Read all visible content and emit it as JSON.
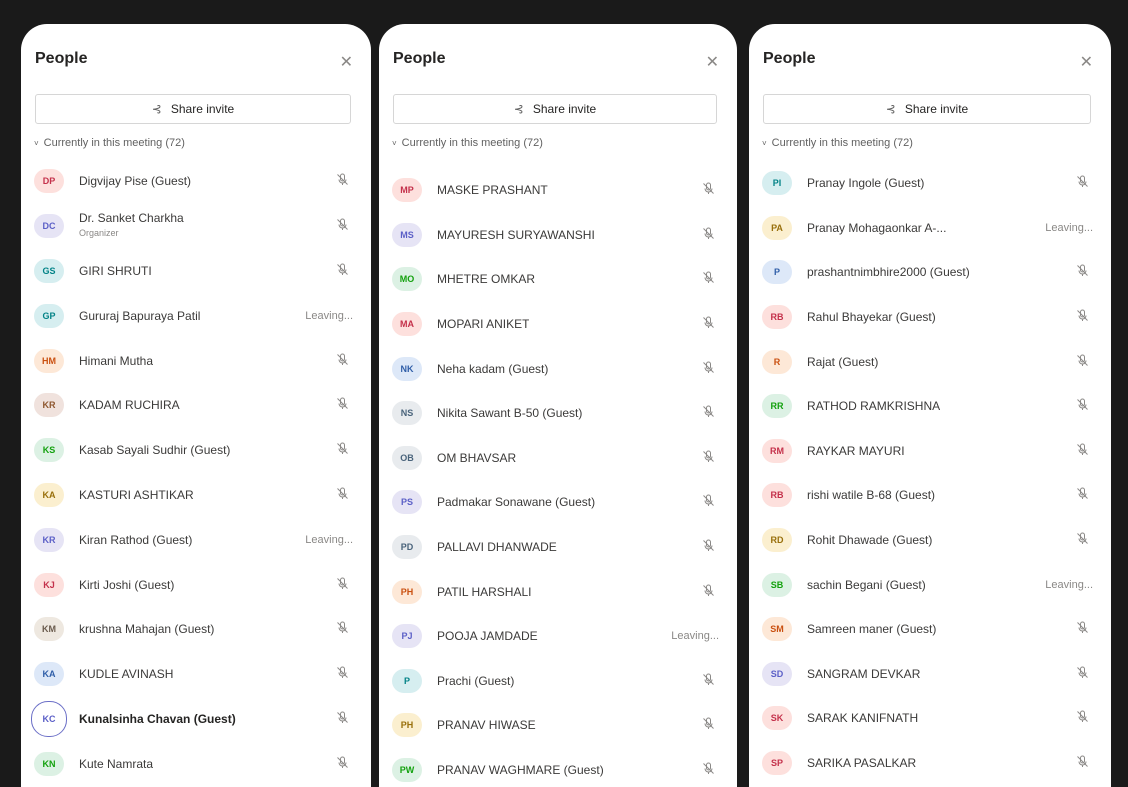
{
  "panel_title": "People",
  "share_label": "Share invite",
  "section_label": "Currently in this meeting (72)",
  "colors": {
    "red": "#c4314b",
    "lav": "#5b5fc7",
    "teal": "#038387",
    "green": "#13a10e",
    "orange": "#ca5010",
    "beige": "#8e562e",
    "yellow": "#986f0b",
    "blue": "#2f5ea8",
    "sand": "#6a5b4d",
    "gray": "#49637b"
  },
  "panels": [
    {
      "participants": [
        {
          "initials": "DP",
          "name": "Digvijay Pise (Guest)",
          "color": "red",
          "status": "muted"
        },
        {
          "initials": "DC",
          "name": "Dr. Sanket Charkha",
          "role": "Organizer",
          "color": "lav",
          "status": "muted"
        },
        {
          "initials": "GS",
          "name": "GIRI SHRUTI",
          "color": "teal",
          "status": "muted"
        },
        {
          "initials": "GP",
          "name": "Gururaj Bapuraya Patil",
          "color": "teal",
          "status": "Leaving..."
        },
        {
          "initials": "HM",
          "name": "Himani Mutha",
          "color": "orange",
          "status": "muted"
        },
        {
          "initials": "KR",
          "name": "KADAM RUCHIRA",
          "color": "beige",
          "status": "muted"
        },
        {
          "initials": "KS",
          "name": "Kasab Sayali Sudhir (Guest)",
          "color": "green",
          "status": "muted"
        },
        {
          "initials": "KA",
          "name": "KASTURI ASHTIKAR",
          "color": "yellow",
          "status": "muted"
        },
        {
          "initials": "KR",
          "name": "Kiran Rathod (Guest)",
          "color": "lav",
          "status": "Leaving..."
        },
        {
          "initials": "KJ",
          "name": "Kirti Joshi (Guest)",
          "color": "red",
          "status": "muted"
        },
        {
          "initials": "KM",
          "name": "krushna Mahajan (Guest)",
          "color": "sand",
          "status": "muted"
        },
        {
          "initials": "KA",
          "name": "KUDLE AVINASH",
          "color": "blue",
          "status": "muted"
        },
        {
          "initials": "KC",
          "name": "Kunalsinha Chavan (Guest)",
          "color": "white",
          "status": "muted",
          "bold": true
        },
        {
          "initials": "KN",
          "name": "Kute Namrata",
          "color": "green",
          "status": "muted"
        }
      ]
    },
    {
      "participants": [
        {
          "initials": "MP",
          "name": "MASKE PRASHANT",
          "color": "red",
          "status": "muted"
        },
        {
          "initials": "MS",
          "name": "MAYURESH SURYAWANSHI",
          "color": "lav",
          "status": "muted"
        },
        {
          "initials": "MO",
          "name": "MHETRE OMKAR",
          "color": "green",
          "status": "muted"
        },
        {
          "initials": "MA",
          "name": "MOPARI ANIKET",
          "color": "red",
          "status": "muted"
        },
        {
          "initials": "NK",
          "name": "Neha kadam (Guest)",
          "color": "blue",
          "status": "muted"
        },
        {
          "initials": "NS",
          "name": "Nikita Sawant B-50 (Guest)",
          "color": "gray",
          "status": "muted"
        },
        {
          "initials": "OB",
          "name": "OM BHAVSAR",
          "color": "gray",
          "status": "muted"
        },
        {
          "initials": "PS",
          "name": "Padmakar Sonawane (Guest)",
          "color": "lav",
          "status": "muted"
        },
        {
          "initials": "PD",
          "name": "PALLAVI DHANWADE",
          "color": "gray",
          "status": "muted"
        },
        {
          "initials": "PH",
          "name": "PATIL HARSHALI",
          "color": "orange",
          "status": "muted"
        },
        {
          "initials": "PJ",
          "name": "POOJA JAMDADE",
          "color": "lav",
          "status": "Leaving..."
        },
        {
          "initials": "P",
          "name": "Prachi (Guest)",
          "color": "teal",
          "status": "muted"
        },
        {
          "initials": "PH",
          "name": "PRANAV HIWASE",
          "color": "yellow",
          "status": "muted"
        },
        {
          "initials": "PW",
          "name": "PRANAV WAGHMARE (Guest)",
          "color": "green",
          "status": "muted"
        }
      ]
    },
    {
      "participants": [
        {
          "initials": "PI",
          "name": "Pranay Ingole (Guest)",
          "color": "teal",
          "status": "muted"
        },
        {
          "initials": "PA",
          "name": "Pranay Mohagaonkar A-...",
          "color": "yellow",
          "status": "Leaving..."
        },
        {
          "initials": "P",
          "name": "prashantnimbhire2000 (Guest)",
          "color": "blue",
          "status": "muted"
        },
        {
          "initials": "RB",
          "name": "Rahul Bhayekar (Guest)",
          "color": "red",
          "status": "muted"
        },
        {
          "initials": "R",
          "name": "Rajat (Guest)",
          "color": "orange",
          "status": "muted"
        },
        {
          "initials": "RR",
          "name": "RATHOD RAMKRISHNA",
          "color": "green",
          "status": "muted"
        },
        {
          "initials": "RM",
          "name": "RAYKAR MAYURI",
          "color": "red",
          "status": "muted"
        },
        {
          "initials": "RB",
          "name": "rishi watile B-68 (Guest)",
          "color": "red",
          "status": "muted"
        },
        {
          "initials": "RD",
          "name": "Rohit Dhawade (Guest)",
          "color": "yellow",
          "status": "muted"
        },
        {
          "initials": "SB",
          "name": "sachin Begani (Guest)",
          "color": "green",
          "status": "Leaving..."
        },
        {
          "initials": "SM",
          "name": "Samreen maner (Guest)",
          "color": "orange",
          "status": "muted"
        },
        {
          "initials": "SD",
          "name": "SANGRAM DEVKAR",
          "color": "lav",
          "status": "muted"
        },
        {
          "initials": "SK",
          "name": "SARAK KANIFNATH",
          "color": "red",
          "status": "muted"
        },
        {
          "initials": "SP",
          "name": "SARIKA PASALKAR",
          "color": "red",
          "status": "muted"
        }
      ]
    }
  ]
}
